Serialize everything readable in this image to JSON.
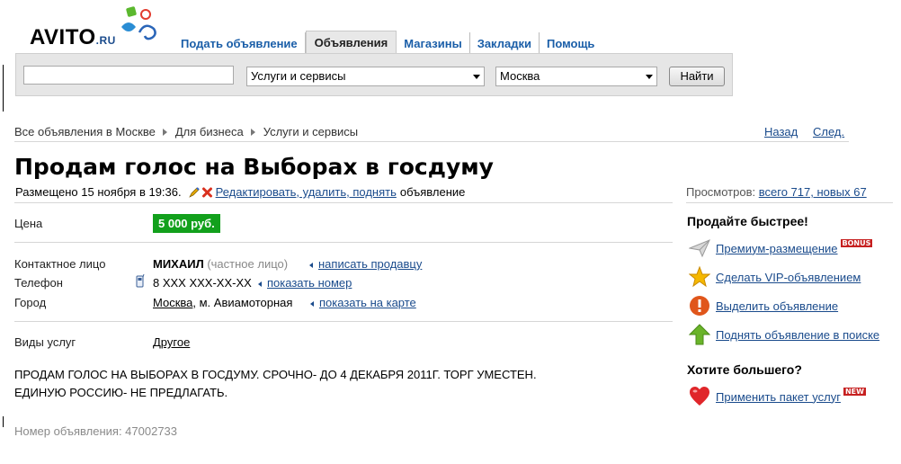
{
  "header": {
    "logo_text": "AVITO",
    "logo_suffix": ".RU",
    "nav": [
      {
        "label": "Подать объявление"
      },
      {
        "label": "Объявления",
        "active": true
      },
      {
        "label": "Магазины"
      },
      {
        "label": "Закладки"
      },
      {
        "label": "Помощь"
      }
    ]
  },
  "search": {
    "query_value": "",
    "category_selected": "Услуги и сервисы",
    "location_selected": "Москва",
    "button_label": "Найти"
  },
  "breadcrumb": {
    "items": [
      "Все объявления в Москве",
      "Для бизнеса",
      "Услуги и сервисы"
    ],
    "back_label": "Назад",
    "next_label": "След."
  },
  "ad": {
    "title": "Продам голос на Выборах в госдуму",
    "posted": "Размещено 15 ноября в 19:36.",
    "edit_link": "Редактировать, удалить, поднять",
    "edit_suffix": "объявление",
    "price_label": "Цена",
    "price_value": "5 000 руб.",
    "contact_label": "Контактное лицо",
    "contact_name": "МИХАИЛ",
    "contact_type": "(частное лицо)",
    "write_seller": "написать продавцу",
    "phone_label": "Телефон",
    "phone_value": "8 XXX XXX-XX-XX",
    "show_number": "показать номер",
    "city_label": "Город",
    "city_link": "Москва",
    "city_metro": ", м. Авиамоторная",
    "show_map": "показать на карте",
    "service_label": "Виды услуг",
    "service_value": "Другое",
    "description_line1": "ПРОДАМ ГОЛОС НА ВЫБОРАХ В ГОСДУМУ. СРОЧНО- ДО 4 ДЕКАБРЯ 2011Г. ТОРГ УМЕСТЕН.",
    "description_line2": "ЕДИНУЮ РОССИЮ- НЕ ПРЕДЛАГАТЬ.",
    "ad_number": "Номер объявления: 47002733"
  },
  "sidebar": {
    "views_prefix": "Просмотров:",
    "views_link": "всего 717, новых 67",
    "sell_faster_heading": "Продайте быстрее!",
    "premium_label": "Премиум-размещение",
    "premium_badge": "BONUS",
    "vip_label": "Сделать VIP-объявлением",
    "highlight_label": "Выделить объявление",
    "raise_label": "Поднять объявление в поиске",
    "want_more_heading": "Хотите большего?",
    "package_label": "Применить пакет услуг",
    "package_badge": "NEW"
  },
  "colors": {
    "link": "#1a4b8c",
    "price_bg": "#12a01c",
    "search_bg": "#e6e6e6"
  }
}
